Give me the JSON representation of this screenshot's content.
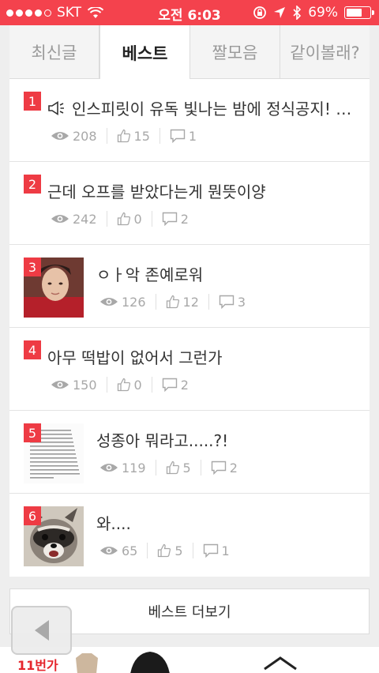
{
  "status_bar": {
    "carrier": "SKT",
    "time": "오전 6:03",
    "battery": "69%",
    "battery_level": 0.69
  },
  "tabs": [
    {
      "label": "최신글",
      "active": false
    },
    {
      "label": "베스트",
      "active": true
    },
    {
      "label": "짤모음",
      "active": false
    },
    {
      "label": "같이볼래?",
      "active": false
    }
  ],
  "items": [
    {
      "rank": "1",
      "title": "인스피릿이 유독 빛나는 밤에 정식공지! …",
      "views": "208",
      "likes": "15",
      "comments": "1",
      "has_megaphone": true,
      "thumb": null
    },
    {
      "rank": "2",
      "title": "근데 오프를 받았다는게 뭔뜻이양",
      "views": "242",
      "likes": "0",
      "comments": "2",
      "thumb": null
    },
    {
      "rank": "3",
      "title": "ㅇㅏ악 존예로워",
      "views": "126",
      "likes": "12",
      "comments": "3",
      "thumb": "portrait"
    },
    {
      "rank": "4",
      "title": "아무 떡밥이 없어서 그런가",
      "views": "150",
      "likes": "0",
      "comments": "2",
      "thumb": null
    },
    {
      "rank": "5",
      "title": "성종아 뭐라고.....?!",
      "views": "119",
      "likes": "5",
      "comments": "2",
      "thumb": "text-doc"
    },
    {
      "rank": "6",
      "title": "와....",
      "views": "65",
      "likes": "5",
      "comments": "1",
      "thumb": "raccoon"
    }
  ],
  "more_button": {
    "label": "베스트 더보기"
  },
  "ad": {
    "logo": "11번가"
  },
  "colors": {
    "accent": "#f4424d",
    "rank_badge": "#ee3b44"
  }
}
